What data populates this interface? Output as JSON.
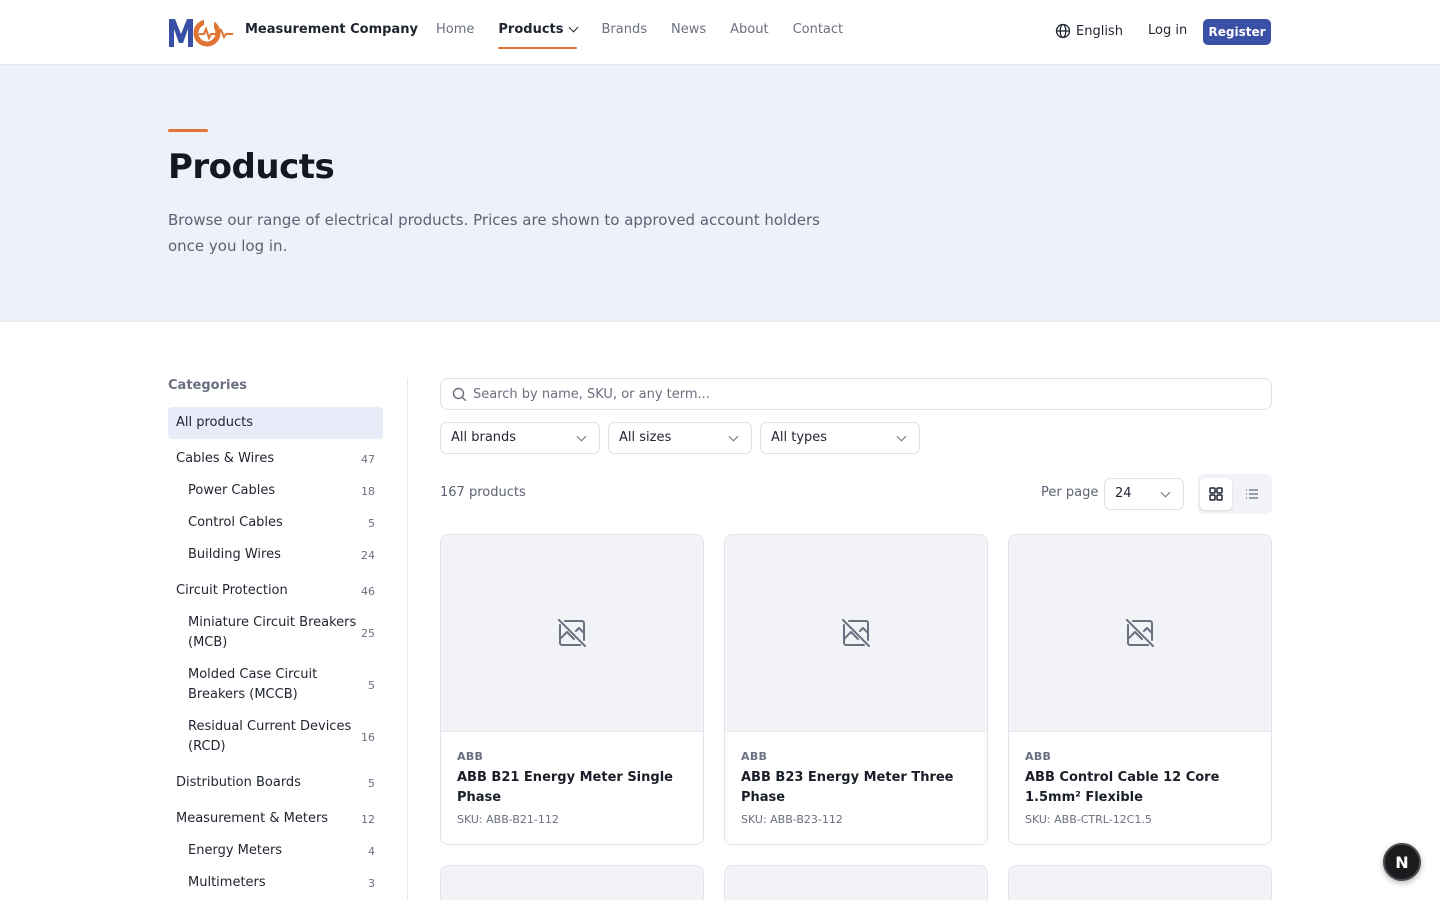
{
  "header": {
    "logo_text": "MC",
    "brand_name": "Measurement Company",
    "nav": [
      {
        "label": "Home"
      },
      {
        "label": "Products"
      },
      {
        "label": "Brands"
      },
      {
        "label": "News"
      },
      {
        "label": "About"
      },
      {
        "label": "Contact"
      }
    ],
    "language": "English",
    "login": "Log in",
    "register": "Register"
  },
  "hero": {
    "title": "Products",
    "description": "Browse our range of electrical products. Prices are shown to approved account holders once you log in."
  },
  "sidebar": {
    "heading": "Categories",
    "all": "All products",
    "categories": [
      {
        "label": "Cables & Wires",
        "count": "47",
        "level": 0
      },
      {
        "label": "Power Cables",
        "count": "18",
        "level": 1
      },
      {
        "label": "Control Cables",
        "count": "5",
        "level": 1
      },
      {
        "label": "Building Wires",
        "count": "24",
        "level": 1
      },
      {
        "label": "Circuit Protection",
        "count": "46",
        "level": 0
      },
      {
        "label": "Miniature Circuit Breakers (MCB)",
        "count": "25",
        "level": 1
      },
      {
        "label": "Molded Case Circuit Breakers (MCCB)",
        "count": "5",
        "level": 1
      },
      {
        "label": "Residual Current Devices (RCD)",
        "count": "16",
        "level": 1
      },
      {
        "label": "Distribution Boards",
        "count": "5",
        "level": 0
      },
      {
        "label": "Measurement & Meters",
        "count": "12",
        "level": 0
      },
      {
        "label": "Energy Meters",
        "count": "4",
        "level": 1
      },
      {
        "label": "Multimeters",
        "count": "3",
        "level": 1
      }
    ]
  },
  "filters": {
    "search_placeholder": "Search by name, SKU, or any term...",
    "brand": "All brands",
    "size": "All sizes",
    "type": "All types"
  },
  "results": {
    "count_label": "167 products",
    "per_page_label": "Per page",
    "per_page_value": "24"
  },
  "products": [
    {
      "brand": "ABB",
      "title": "ABB B21 Energy Meter Single Phase",
      "sku": "SKU: ABB-B21-112"
    },
    {
      "brand": "ABB",
      "title": "ABB B23 Energy Meter Three Phase",
      "sku": "SKU: ABB-B23-112"
    },
    {
      "brand": "ABB",
      "title": "ABB Control Cable 12 Core 1.5mm² Flexible",
      "sku": "SKU: ABB-CTRL-12C1.5"
    }
  ],
  "fab": "N",
  "colors": {
    "accent": "#e07434",
    "primary": "#3a4fa6",
    "hero_bg": "#eef1f9"
  }
}
